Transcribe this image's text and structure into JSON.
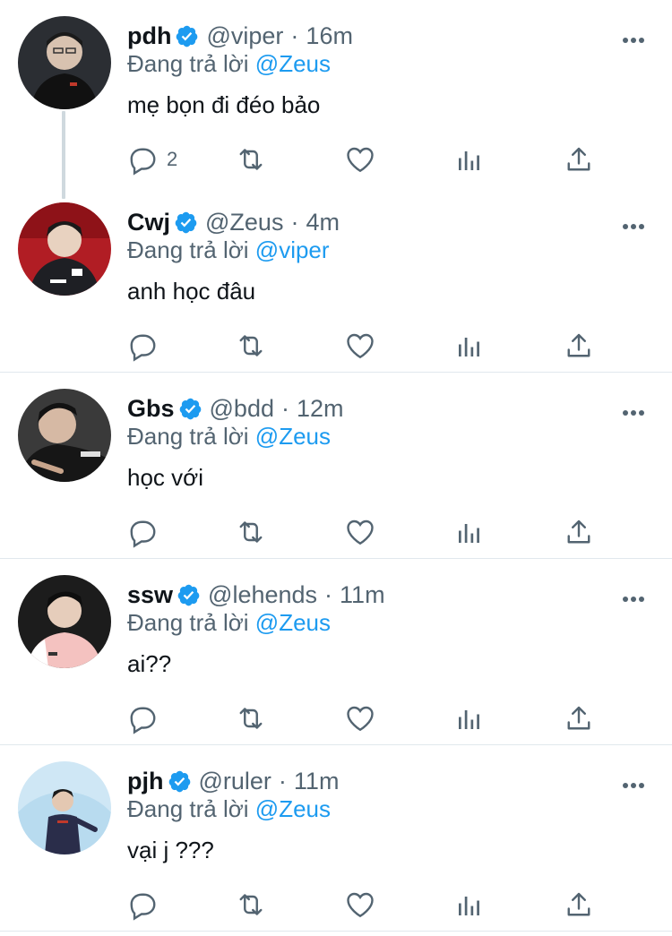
{
  "reply_prefix": "Đang trả lời",
  "colors": {
    "accent": "#1d9bf0",
    "secondary_text": "#536471",
    "primary_text": "#0f1419",
    "divider": "#e1e8ed"
  },
  "icons": {
    "verified": "verified-badge-icon",
    "more": "more-options-icon",
    "reply": "reply-icon",
    "retweet": "retweet-icon",
    "like": "like-icon",
    "analytics": "analytics-icon",
    "share": "share-icon"
  },
  "tweets": [
    {
      "name": "pdh",
      "handle": "@viper",
      "separator": "·",
      "time": "16m",
      "reply_to": "@Zeus",
      "text": "mẹ bọn đi đéo bảo",
      "reply_count": "2"
    },
    {
      "name": "Cwj",
      "handle": "@Zeus",
      "separator": "·",
      "time": "4m",
      "reply_to": "@viper",
      "text": "anh học đâu",
      "reply_count": ""
    },
    {
      "name": "Gbs",
      "handle": "@bdd",
      "separator": "·",
      "time": "12m",
      "reply_to": "@Zeus",
      "text": "học với",
      "reply_count": ""
    },
    {
      "name": "ssw",
      "handle": "@lehends",
      "separator": "·",
      "time": "11m",
      "reply_to": "@Zeus",
      "text": "ai??",
      "reply_count": ""
    },
    {
      "name": "pjh",
      "handle": "@ruler",
      "separator": "·",
      "time": "11m",
      "reply_to": "@Zeus",
      "text": "vại j ???",
      "reply_count": ""
    }
  ]
}
